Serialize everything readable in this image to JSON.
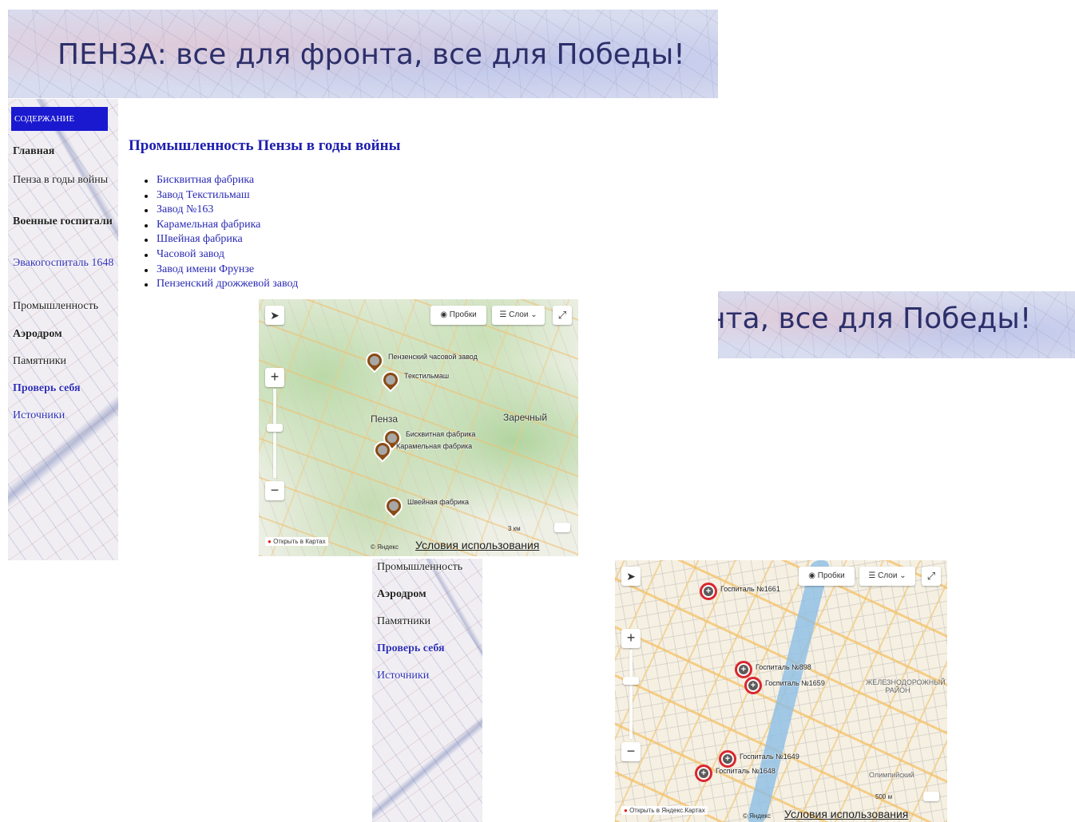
{
  "header": {
    "title": "ПЕНЗА: все для фронта, все для Победы!",
    "title_fragment": "нта, все для Победы!"
  },
  "sidebar": {
    "header": "СОДЕРЖАНИЕ",
    "items": [
      {
        "label": "Главная"
      },
      {
        "label": "Пенза в годы войны"
      },
      {
        "label": "Военные госпитали"
      },
      {
        "label": "Эвакогоспиталь 1648"
      },
      {
        "label": "Промышленность"
      },
      {
        "label": "Аэродром"
      },
      {
        "label": "Памятники"
      },
      {
        "label": "Проверь себя"
      },
      {
        "label": "Источники"
      }
    ]
  },
  "main": {
    "title": "Промышленность Пензы в годы войны",
    "links": [
      "Бисквитная фабрика",
      "Завод Текстильмаш",
      "Завод №163",
      "Карамельная фабрика",
      "Швейная фабрика",
      "Часовой завод",
      "Завод имени Фрунзе",
      "Пензенский дрожжевой завод"
    ]
  },
  "map1": {
    "traffic_label": "Пробки",
    "layers_label": "Слои",
    "zoom_in": "+",
    "zoom_out": "−",
    "open_in_maps": "Открыть в Картах",
    "copyright": "© Яндекс",
    "terms": "Условия использования",
    "scale": "3 км",
    "places": [
      "Пенза",
      "Заречный"
    ],
    "markers": [
      "Пензенский часовой завод",
      "Текстильмаш",
      "Бисквитная фабрика",
      "Карамельная фабрика",
      "Швейная фабрика"
    ]
  },
  "map2": {
    "traffic_label": "Пробки",
    "layers_label": "Слои",
    "zoom_in": "+",
    "zoom_out": "−",
    "open_in_maps": "Открыть в Яндекс.Картах",
    "copyright": "© Яндекс",
    "terms": "Условия использования",
    "scale": "500 м",
    "places": [
      "ЖЕЛЕЗНОДОРОЖНЫЙ РАЙОН",
      "Олимпийский"
    ],
    "markers": [
      "Госпиталь №1661",
      "Госпиталь №898",
      "Госпиталь №1659",
      "Госпиталь №1649",
      "Госпиталь №1648"
    ]
  },
  "colors": {
    "toc_header_bg": "#1a19d0",
    "title_color": "#1f1fb0",
    "link_color": "#2a2ab5",
    "pin_brown": "#8a4b14",
    "hospital_red": "#d8282f"
  }
}
